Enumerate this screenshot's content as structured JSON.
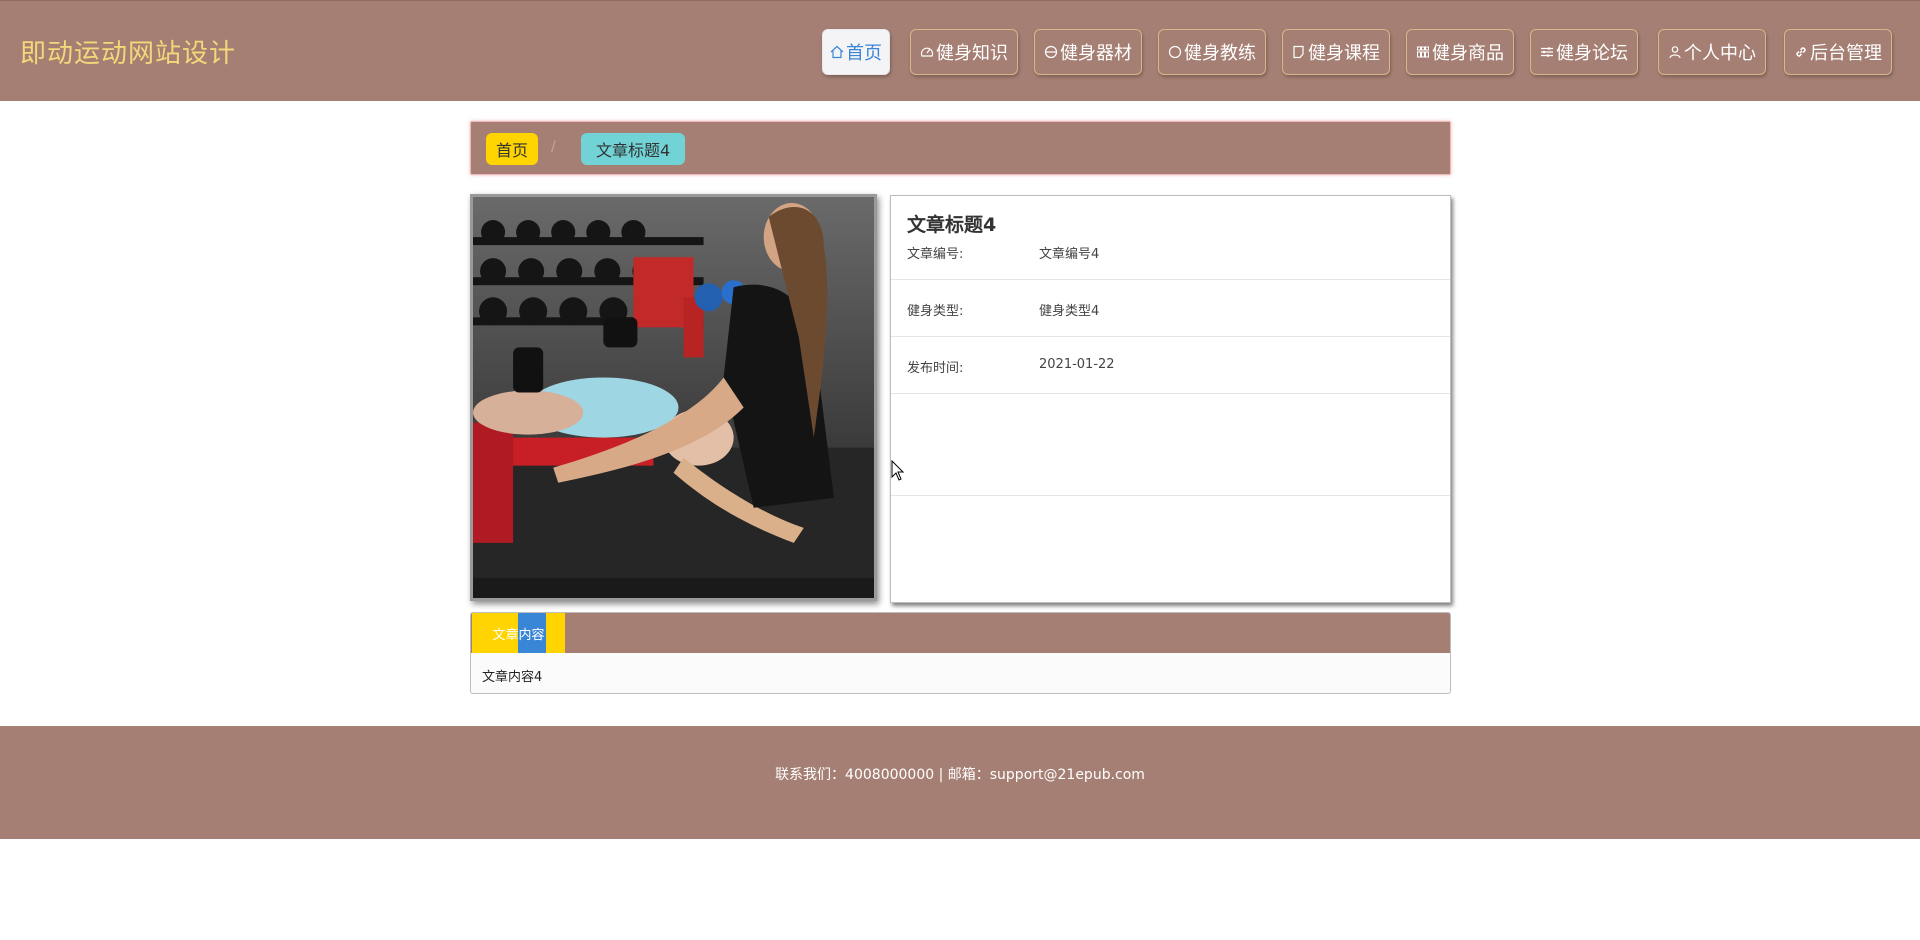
{
  "header": {
    "site_title": "即动运动网站设计",
    "nav": [
      {
        "label": "首页",
        "icon": "home-icon"
      },
      {
        "label": "健身知识",
        "icon": "gauge-icon"
      },
      {
        "label": "健身器材",
        "icon": "disc-icon"
      },
      {
        "label": "健身教练",
        "icon": "circle-icon"
      },
      {
        "label": "健身课程",
        "icon": "note-icon"
      },
      {
        "label": "健身商品",
        "icon": "grid-icon"
      },
      {
        "label": "健身论坛",
        "icon": "sliders-icon"
      },
      {
        "label": "个人中心",
        "icon": "user-icon"
      },
      {
        "label": "后台管理",
        "icon": "link-icon"
      }
    ],
    "active_nav": "首页"
  },
  "breadcrumb": {
    "home": "首页",
    "separator": "/",
    "current": "文章标题4"
  },
  "article": {
    "title": "文章标题4",
    "fields": [
      {
        "label": "文章编号:",
        "value": "文章编号4"
      },
      {
        "label": "健身类型:",
        "value": "健身类型4"
      },
      {
        "label": "发布时间:",
        "value": "2021-01-22"
      }
    ],
    "image_alt": "gym-photo-trainer-and-woman-dumbbell-press"
  },
  "content": {
    "tab_label": "文章内容",
    "text": "文章内容4"
  },
  "footer": {
    "text": "联系我们：4008000000 | 邮箱：support@21epub.com"
  },
  "colors": {
    "brand_bg": "#a57f73",
    "title_gold": "#f5d77a",
    "crumb_home": "#ffd400",
    "crumb_current": "#72d3d6",
    "active_blue": "#3a86d6"
  }
}
